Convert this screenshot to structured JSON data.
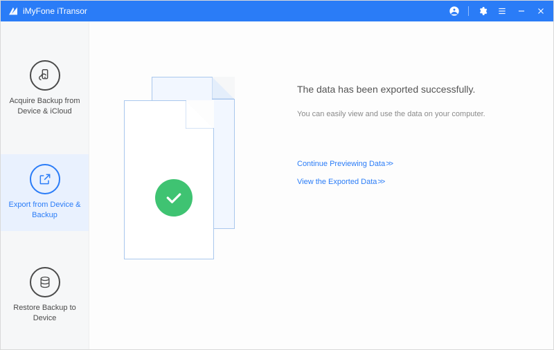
{
  "app": {
    "title": "iMyFone iTransor"
  },
  "titlebar_icons": {
    "account": "account-icon",
    "settings": "gear-icon",
    "menu": "menu-icon",
    "minimize": "minimize-icon",
    "close": "close-icon"
  },
  "sidebar": {
    "items": [
      {
        "id": "acquire",
        "label": "Acquire Backup from Device & iCloud",
        "icon": "device-cloud-icon"
      },
      {
        "id": "export",
        "label": "Export from Device & Backup",
        "icon": "export-icon"
      },
      {
        "id": "restore",
        "label": "Restore Backup to Device",
        "icon": "database-icon"
      }
    ],
    "active_id": "export"
  },
  "main": {
    "headline": "The data has been exported successfully.",
    "subtext": "You can easily view and use the data on your computer.",
    "links": {
      "continue_preview": "Continue Previewing Data",
      "view_exported": "View the Exported Data"
    },
    "link_suffix": " >>",
    "status_illustration": "document-success-check",
    "colors": {
      "brand_blue": "#2a7cf7",
      "success_green": "#3fc372"
    }
  }
}
